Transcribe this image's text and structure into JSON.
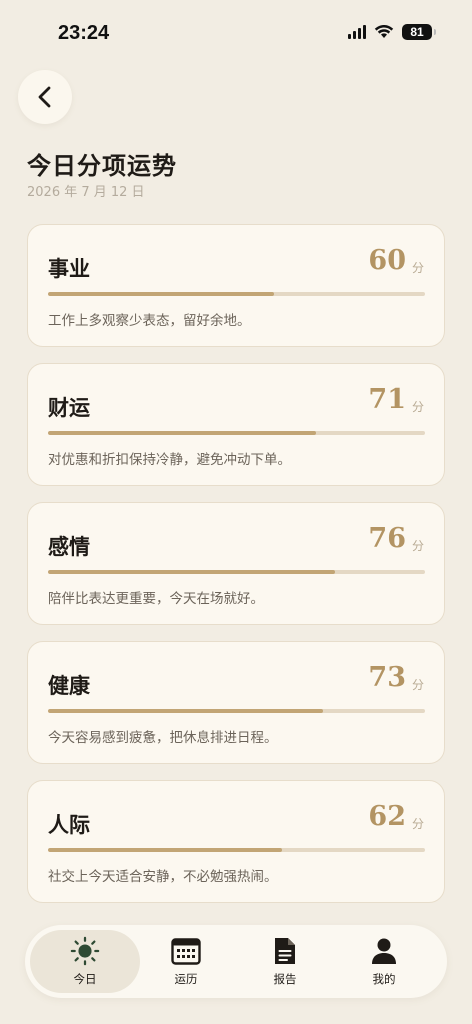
{
  "status_bar": {
    "time": "23:24",
    "battery": "81"
  },
  "header": {
    "title": "今日分项运势",
    "date": "2026 年 7 月 12 日"
  },
  "score_unit": "分",
  "categories": [
    {
      "name": "事业",
      "score": 60,
      "description": "工作上多观察少表态，留好余地。"
    },
    {
      "name": "财运",
      "score": 71,
      "description": "对优惠和折扣保持冷静，避免冲动下单。"
    },
    {
      "name": "感情",
      "score": 76,
      "description": "陪伴比表达更重要，今天在场就好。"
    },
    {
      "name": "健康",
      "score": 73,
      "description": "今天容易感到疲惫，把休息排进日程。"
    },
    {
      "name": "人际",
      "score": 62,
      "description": "社交上今天适合安静，不必勉强热闹。"
    }
  ],
  "tabs": [
    {
      "label": "今日",
      "icon": "sun-icon",
      "active": true
    },
    {
      "label": "运历",
      "icon": "calendar-icon",
      "active": false
    },
    {
      "label": "报告",
      "icon": "document-icon",
      "active": false
    },
    {
      "label": "我的",
      "icon": "person-icon",
      "active": false
    }
  ],
  "colors": {
    "background": "#f2ede3",
    "accent": "#b39463",
    "active_icon": "#2e4a33"
  }
}
